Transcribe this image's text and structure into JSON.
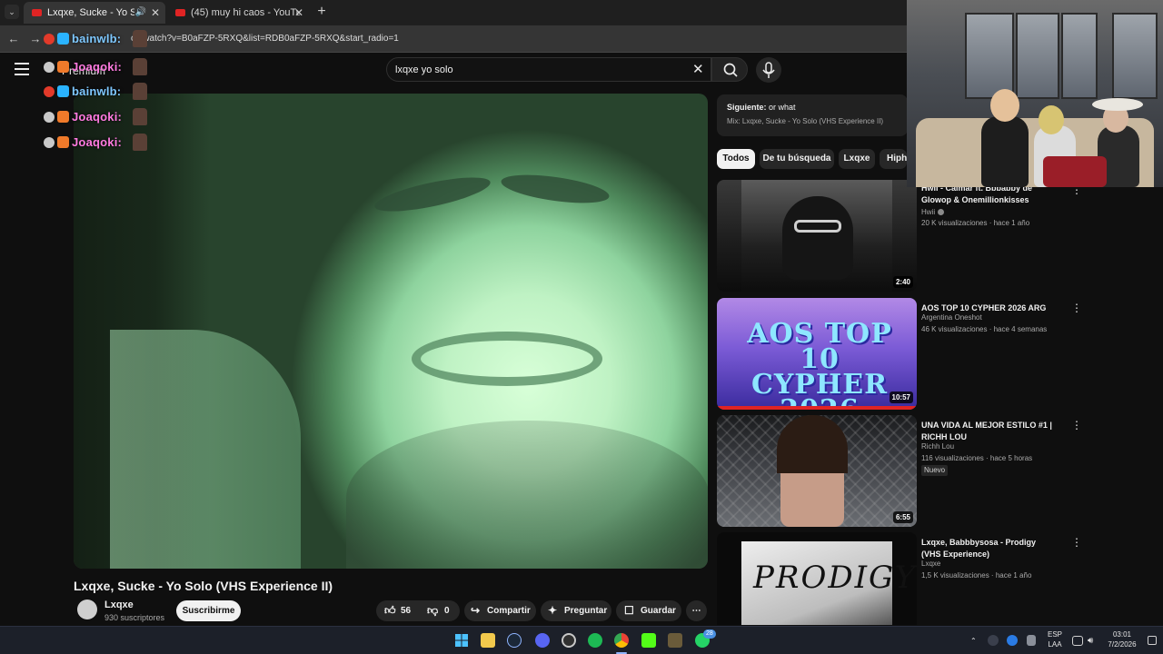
{
  "browser": {
    "tabs": [
      {
        "label": "Lxqxe, Sucke - Yo Solo",
        "active": true
      },
      {
        "label": "(45) muy hi caos - YouTube",
        "active": false
      }
    ],
    "url": "co/watch?v=B0aFZP-5RXQ&list=RDB0aFZP-5RXQ&start_radio=1"
  },
  "chat_overlay": [
    {
      "name": "Joaqoki:",
      "color": "#ff7ae0"
    },
    {
      "name": "bainwlb:",
      "color": "#7ec8ff"
    },
    {
      "name": "Joaqoki:",
      "color": "#ff7ae0"
    },
    {
      "name": "Joaqoki:",
      "color": "#ff7ae0"
    }
  ],
  "chat_overlay_top": {
    "name": "bainwlb:",
    "color": "#7ec8ff"
  },
  "header": {
    "logo_label": "Premium",
    "search_value": "lxqxe yo solo"
  },
  "video": {
    "title": "Lxqxe, Sucke - Yo Solo (VHS Experience II)",
    "channel": "Lxqxe",
    "subscribers": "930 suscriptores",
    "subscribe_label": "Suscribirme",
    "likes": "56",
    "dislikes": "0",
    "share_label": "Compartir",
    "ask_label": "Preguntar",
    "save_label": "Guardar"
  },
  "up_next": {
    "label": "Siguiente:",
    "next_title": "or what",
    "mix": "Mix: Lxqxe, Sucke - Yo Solo (VHS Experience II)"
  },
  "chips": [
    "Todos",
    "De tu búsqueda",
    "Lxqxe",
    "Hiphop"
  ],
  "recommendations": [
    {
      "title": "Hwii - Calmar ft. Bbbabby de Glowop & Onemillionkisses",
      "channel": "Hwii",
      "verified": true,
      "meta": "20 K visualizaciones · hace 1 año",
      "duration": "2:40",
      "badge": ""
    },
    {
      "title": "AOS TOP 10 CYPHER 2026 ARG",
      "channel": "Argentina Oneshot",
      "verified": false,
      "meta": "46 K visualizaciones · hace 4 semanas",
      "duration": "10:57",
      "badge": "",
      "thumb_text": "AOS TOP 10 CYPHER 2026"
    },
    {
      "title": "UNA VIDA AL MEJOR ESTILO #1 | RICHH LOU",
      "channel": "Richh Lou",
      "verified": false,
      "meta": "116 visualizaciones · hace 5 horas",
      "duration": "6:55",
      "badge": "Nuevo"
    },
    {
      "title": "Lxqxe, Babbbysosa - Prodigy (VHS Experience)",
      "channel": "Lxqxe",
      "verified": false,
      "meta": "1,5 K visualizaciones · hace 1 año",
      "duration": "",
      "badge": "",
      "thumb_text": "PRODIGY"
    }
  ],
  "taskbar": {
    "lang_top": "ESP",
    "lang_bottom": "LAA",
    "time": "03:01",
    "date": "7/2/2026",
    "whatsapp_badge": "28"
  },
  "colors": {
    "accent_red": "#e02424",
    "background": "#0f0f0f",
    "chip_bg": "#272727"
  }
}
